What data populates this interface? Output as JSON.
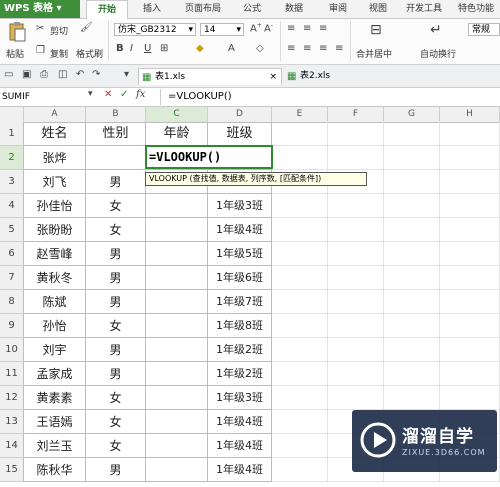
{
  "app": {
    "title": "WPS 表格"
  },
  "menu": [
    "开始",
    "插入",
    "页面布局",
    "公式",
    "数据",
    "审阅",
    "视图",
    "开发工具",
    "特色功能"
  ],
  "ribbon": {
    "cut": "剪切",
    "paste": "粘贴",
    "copy": "复制",
    "format_painter": "格式刷",
    "font_name": "仿宋_GB2312",
    "font_size": "14",
    "merge_center": "合并居中",
    "wrap": "自动换行",
    "number_format": "常规"
  },
  "file_tabs": [
    "表1.xls",
    "表2.xls"
  ],
  "formula_bar": {
    "name_box": "SUMIF",
    "formula": "=VLOOKUP()"
  },
  "columns": [
    "A",
    "B",
    "C",
    "D",
    "E",
    "F",
    "G",
    "H"
  ],
  "rows": [
    {
      "n": "1",
      "a": "姓名",
      "b": "性别",
      "c": "年龄",
      "d": "班级"
    },
    {
      "n": "2",
      "a": "张烨",
      "b": "",
      "c": "",
      "d": ""
    },
    {
      "n": "3",
      "a": "刘飞",
      "b": "男",
      "c": "",
      "d": ""
    },
    {
      "n": "4",
      "a": "孙佳怡",
      "b": "女",
      "c": "",
      "d": "1年级3班"
    },
    {
      "n": "5",
      "a": "张盼盼",
      "b": "女",
      "c": "",
      "d": "1年级4班"
    },
    {
      "n": "6",
      "a": "赵雪峰",
      "b": "男",
      "c": "",
      "d": "1年级5班"
    },
    {
      "n": "7",
      "a": "黄秋冬",
      "b": "男",
      "c": "",
      "d": "1年级6班"
    },
    {
      "n": "8",
      "a": "陈斌",
      "b": "男",
      "c": "",
      "d": "1年级7班"
    },
    {
      "n": "9",
      "a": "孙怡",
      "b": "女",
      "c": "",
      "d": "1年级8班"
    },
    {
      "n": "10",
      "a": "刘宇",
      "b": "男",
      "c": "",
      "d": "1年级2班"
    },
    {
      "n": "11",
      "a": "孟家成",
      "b": "男",
      "c": "",
      "d": "1年级2班"
    },
    {
      "n": "12",
      "a": "黄素素",
      "b": "女",
      "c": "",
      "d": "1年级3班"
    },
    {
      "n": "13",
      "a": "王语嫣",
      "b": "女",
      "c": "",
      "d": "1年级4班"
    },
    {
      "n": "14",
      "a": "刘兰玉",
      "b": "女",
      "c": "",
      "d": "1年级4班"
    },
    {
      "n": "15",
      "a": "陈秋华",
      "b": "男",
      "c": "",
      "d": "1年级4班"
    }
  ],
  "editing": {
    "formula": "=VLOOKUP()",
    "tooltip": "VLOOKUP (查找值, 数据表, 列序数, [匹配条件])"
  },
  "watermark": {
    "name": "溜溜自学",
    "url": "ZIXUE.3D66.COM"
  }
}
